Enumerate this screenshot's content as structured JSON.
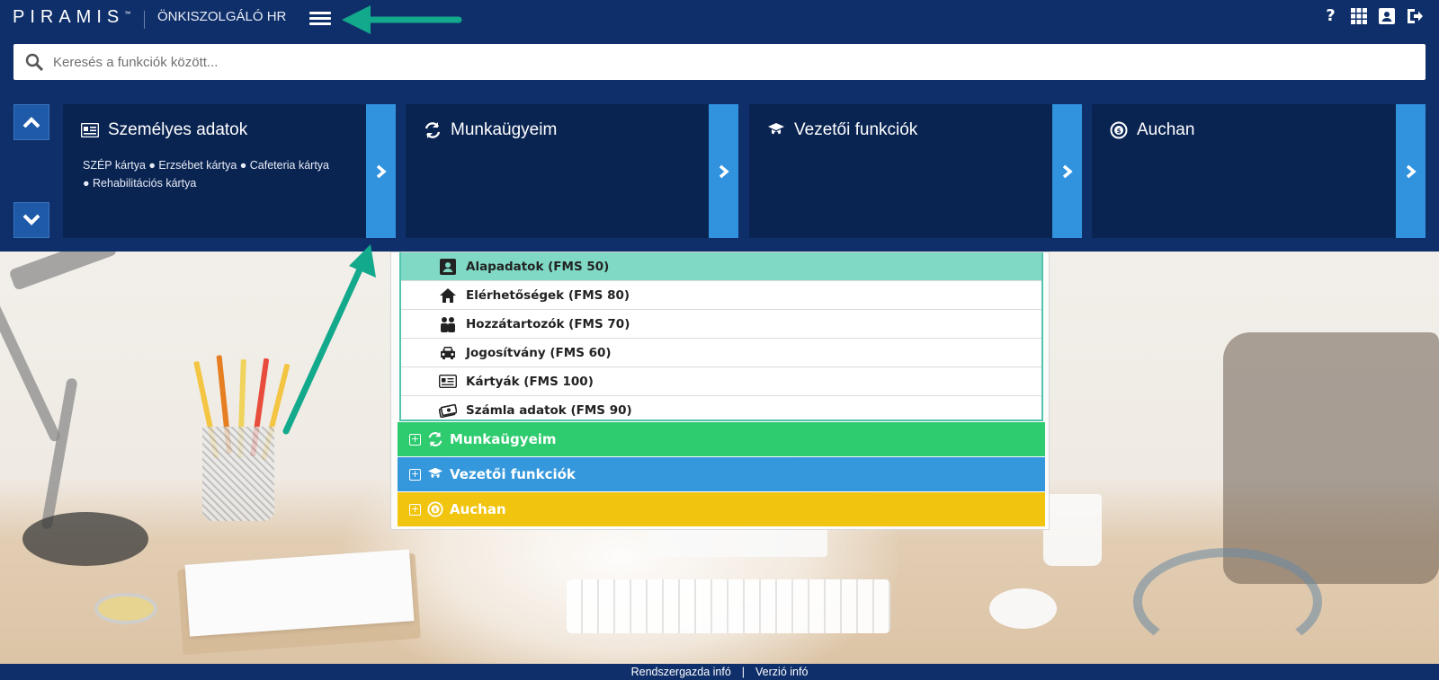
{
  "header": {
    "logo_text": "PIRAMIS",
    "logo_tm": "™",
    "app_title": "ÖNKISZOLGÁLÓ HR",
    "icons": [
      {
        "name": "help-icon",
        "glyph": "?"
      },
      {
        "name": "apps-grid-icon",
        "glyph": ""
      },
      {
        "name": "profile-card-icon",
        "glyph": ""
      },
      {
        "name": "logout-icon",
        "glyph": ""
      }
    ]
  },
  "search": {
    "placeholder": "Keresés a funkciók között...",
    "value": ""
  },
  "tiles": [
    {
      "title": "Személyes adatok",
      "subtitle": "SZÉP kártya ● Erzsébet kártya ● Cafeteria kártya ● Rehabilitációs kártya",
      "icon": "id-card-icon"
    },
    {
      "title": "Munkaügyeim",
      "subtitle": "",
      "icon": "rotate-icon"
    },
    {
      "title": "Vezetői funkciók",
      "subtitle": "",
      "icon": "graduate-icon"
    },
    {
      "title": "Auchan",
      "subtitle": "",
      "icon": "coin-icon"
    }
  ],
  "submenu": [
    {
      "label": "Alapadatok (FMS 50)",
      "icon": "user-box-icon",
      "active": true
    },
    {
      "label": "Elérhetőségek (FMS 80)",
      "icon": "home-icon",
      "active": false
    },
    {
      "label": "Hozzátartozók (FMS 70)",
      "icon": "family-icon",
      "active": false
    },
    {
      "label": "Jogosítvány (FMS 60)",
      "icon": "car-icon",
      "active": false
    },
    {
      "label": "Kártyák (FMS 100)",
      "icon": "id-card-icon",
      "active": false
    },
    {
      "label": "Számla adatok (FMS 90)",
      "icon": "money-icon",
      "active": false
    }
  ],
  "groups": [
    {
      "label": "Munkaügyeim",
      "color": "#2ecb6f",
      "icon": "rotate-icon"
    },
    {
      "label": "Vezetői funkciók",
      "color": "#3598dc",
      "icon": "graduate-icon"
    },
    {
      "label": "Auchan",
      "color": "#f1c40f",
      "icon": "coin-icon"
    }
  ],
  "footer": {
    "admin_info": "Rendszergazda infó",
    "separator": "|",
    "version_info": "Verzió infó"
  },
  "colors": {
    "header_bg": "#0f2f6a",
    "tile_bg": "#0a2452",
    "tile_arrow": "#3192de",
    "active_item": "#7fd9c5",
    "annotation_arrow": "#13a98c"
  }
}
